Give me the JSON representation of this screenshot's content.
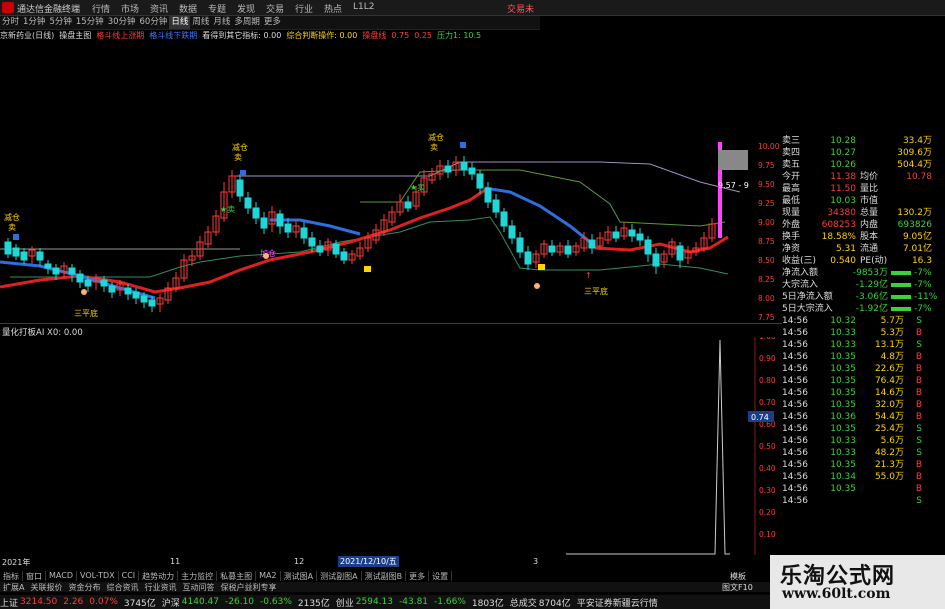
{
  "window": {
    "title": "通达信金融终端",
    "trade_link": "交易未"
  },
  "menu": [
    "行情",
    "市场",
    "资讯",
    "数据",
    "专题",
    "发现",
    "交易",
    "行业",
    "热点",
    "L1L2"
  ],
  "periods": [
    {
      "label": "分时",
      "active": false
    },
    {
      "label": "1分钟",
      "active": false
    },
    {
      "label": "5分钟",
      "active": false
    },
    {
      "label": "15分钟",
      "active": false
    },
    {
      "label": "30分钟",
      "active": false
    },
    {
      "label": "60分钟",
      "active": false
    },
    {
      "label": "日线",
      "active": true
    },
    {
      "label": "周线",
      "active": false
    },
    {
      "label": "月线",
      "active": false
    },
    {
      "label": "多周期",
      "active": false
    },
    {
      "label": "更多",
      "active": false
    }
  ],
  "indicator_line": [
    {
      "text": "京新药业(日线)",
      "color": "#dddddd"
    },
    {
      "text": "操盘主图",
      "color": "#dddddd"
    },
    {
      "text": "格斗线上涨期",
      "color": "#ff3b3b"
    },
    {
      "text": "格斗线下跌期",
      "color": "#3a7bff"
    },
    {
      "text": "看得到其它指标: 0.00",
      "color": "#dddddd"
    },
    {
      "text": "综合判断操作: 0.00",
      "color": "#ffd400"
    },
    {
      "text": "操盘线",
      "color": "#ff3b3b"
    },
    {
      "text": "0.75",
      "color": "#ff3b3b"
    },
    {
      "text": "0.25",
      "color": "#ff3b3b"
    },
    {
      "text": "压力1: 10.5",
      "color": "#3bd13b"
    }
  ],
  "chart_annotations": {
    "jiancang": "减仓",
    "mai": "卖",
    "mai_star": "★卖",
    "sanpingdi_1": "三平底",
    "sanpingdi_2": "三平底",
    "diamond_1": "◆",
    "zhuli": "加仓",
    "yuan": "↑",
    "price_label": "9.57 - 9"
  },
  "price_axis": [
    "10.00",
    "9.75",
    "9.50",
    "9.25",
    "9.00",
    "8.75",
    "8.50",
    "8.25",
    "8.00",
    "7.75"
  ],
  "sub_axis": [
    "1.00",
    "0.90",
    "0.80",
    "0.70",
    "0.60",
    "0.50",
    "0.40",
    "0.30",
    "0.20",
    "0.10"
  ],
  "sub_marker": "0.74",
  "sub_label": "量化打板AI X0: 0.00",
  "quote_panel": [
    {
      "label": "卖三",
      "value": "10.28",
      "value_color": "#3bd13b",
      "extra": "33.4万",
      "extra_color": "#ffd400"
    },
    {
      "label": "卖四",
      "value": "10.27",
      "value_color": "#3bd13b",
      "extra": "309.6万",
      "extra_color": "#ffd400"
    },
    {
      "label": "卖五",
      "value": "10.26",
      "value_color": "#3bd13b",
      "extra": "504.4万",
      "extra_color": "#ffd400"
    },
    {
      "label": "今开",
      "value": "11.38",
      "value_color": "#ff3b3b",
      "label2": "均价",
      "value2": "10.78",
      "value2_color": "#ff3b3b"
    },
    {
      "label": "最高",
      "value": "11.50",
      "value_color": "#ff3b3b",
      "label2": "量比",
      "value2": "",
      "value2_color": "#ff3b3b"
    },
    {
      "label": "最低",
      "value": "10.03",
      "value_color": "#3bd13b",
      "label2": "市值",
      "value2": "",
      "value2_color": "#ffd400"
    },
    {
      "label": "现量",
      "value": "34380",
      "value_color": "#ff3b3b",
      "label2": "总量",
      "value2": "130.2万",
      "value2_color": "#ffd400"
    },
    {
      "label": "外盘",
      "value": "608253",
      "value_color": "#ff3b3b",
      "label2": "内盘",
      "value2": "693826",
      "value2_color": "#3bd13b"
    },
    {
      "label": "换手",
      "value": "18.58%",
      "value_color": "#ffd400",
      "label2": "股本",
      "value2": "9.05亿",
      "value2_color": "#ffd400"
    },
    {
      "label": "净资",
      "value": "5.31",
      "value_color": "#ffd400",
      "label2": "流通",
      "value2": "7.01亿",
      "value2_color": "#ffd400"
    },
    {
      "label": "收益(三)",
      "value": "0.540",
      "value_color": "#ffd400",
      "label2": "PE(动)",
      "value2": "16.3",
      "value2_color": "#ffd400"
    }
  ],
  "flow_panel": [
    {
      "label": "净流入额",
      "value": "-9853万",
      "extra": "-7%"
    },
    {
      "label": "大宗流入",
      "value": "-1.29亿",
      "extra": "-7%"
    },
    {
      "label": "5日净流入额",
      "value": "-3.06亿",
      "extra": "-11%"
    },
    {
      "label": "5日大宗流入",
      "value": "-1.92亿",
      "extra": "-7%"
    }
  ],
  "ticks": [
    {
      "time": "14:56",
      "price": "10.32",
      "vol": "5.7万",
      "dir": "S"
    },
    {
      "time": "14:56",
      "price": "10.33",
      "vol": "5.3万",
      "dir": "B"
    },
    {
      "time": "14:56",
      "price": "10.33",
      "vol": "13.1万",
      "dir": "S"
    },
    {
      "time": "14:56",
      "price": "10.35",
      "vol": "4.8万",
      "dir": "B"
    },
    {
      "time": "14:56",
      "price": "10.35",
      "vol": "22.6万",
      "dir": "B"
    },
    {
      "time": "14:56",
      "price": "10.35",
      "vol": "76.4万",
      "dir": "B"
    },
    {
      "time": "14:56",
      "price": "10.35",
      "vol": "14.6万",
      "dir": "B"
    },
    {
      "time": "14:56",
      "price": "10.35",
      "vol": "32.0万",
      "dir": "B"
    },
    {
      "time": "14:56",
      "price": "10.36",
      "vol": "54.4万",
      "dir": "B"
    },
    {
      "time": "14:56",
      "price": "10.35",
      "vol": "25.4万",
      "dir": "S"
    },
    {
      "time": "14:56",
      "price": "10.33",
      "vol": "5.6万",
      "dir": "S"
    },
    {
      "time": "14:56",
      "price": "10.33",
      "vol": "48.2万",
      "dir": "S"
    },
    {
      "time": "14:56",
      "price": "10.35",
      "vol": "21.3万",
      "dir": "B"
    },
    {
      "time": "14:56",
      "price": "10.34",
      "vol": "55.0万",
      "dir": "B"
    },
    {
      "time": "14:56",
      "price": "10.35",
      "vol": "",
      "dir": "B"
    },
    {
      "time": "14:56",
      "price": "",
      "vol": "",
      "dir": "S"
    }
  ],
  "time_axis": {
    "year_label": "2021年",
    "month_label": "11",
    "month_label2": "12",
    "cursor_date": "2021/12/10/五",
    "m3": "3"
  },
  "bottom_tabs": [
    "指标",
    "窗口",
    "MACD",
    "VOL-TDX",
    "CCI",
    "趋势动力",
    "主力监控",
    "私募主图",
    "MA2",
    "测试图A",
    "测试副图A",
    "测试副图B",
    "更多",
    "设置"
  ],
  "bottom_tabs2": [
    "扩展A",
    "关联报价",
    "资金分布",
    "综合资讯",
    "行业资讯",
    "互动问答",
    "保税户益利专享"
  ],
  "status": [
    {
      "label": "上证",
      "value": "3214.50",
      "value_color": "#ff3b3b"
    },
    {
      "label": "",
      "value": "2.26",
      "value_color": "#ff3b3b"
    },
    {
      "label": "",
      "value": "0.07%",
      "value_color": "#ff3b3b"
    },
    {
      "label": "",
      "value": "3745亿",
      "value_color": "#dddddd"
    },
    {
      "label": "沪深",
      "value": "4140.47",
      "value_color": "#3bd13b"
    },
    {
      "label": "",
      "value": "-26.10",
      "value_color": "#3bd13b"
    },
    {
      "label": "",
      "value": "-0.63%",
      "value_color": "#3bd13b"
    },
    {
      "label": "",
      "value": "2135亿",
      "value_color": "#dddddd"
    },
    {
      "label": "创业",
      "value": "2594.13",
      "value_color": "#3bd13b"
    },
    {
      "label": "",
      "value": "-43.81",
      "value_color": "#3bd13b"
    },
    {
      "label": "",
      "value": "-1.66%",
      "value_color": "#3bd13b"
    },
    {
      "label": "",
      "value": "1803亿",
      "value_color": "#dddddd"
    },
    {
      "label": "总成交",
      "value": "8704亿",
      "value_color": "#dddddd"
    },
    {
      "label": "",
      "value": "平安证券新疆云行情",
      "value_color": "#dddddd"
    }
  ],
  "panel_footer": {
    "left": "图文F10",
    "right": "模板"
  },
  "watermark": {
    "line1": "乐淘公式网",
    "line2": "www.60lt.com"
  },
  "accent_colors": {
    "up": "#ff3b3b",
    "down": "#3bd13b",
    "ma_up": "#e02020",
    "ma_down": "#2d6fe0",
    "bg": "#000000"
  }
}
